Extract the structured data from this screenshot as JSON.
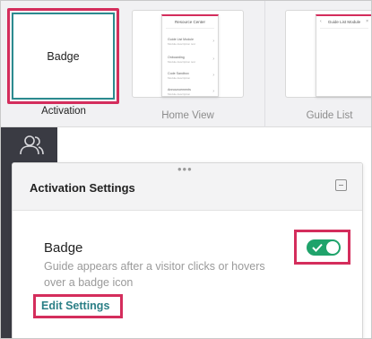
{
  "layouts": {
    "activation": {
      "caption": "Activation",
      "thumb_label": "Badge",
      "selected": true
    },
    "home_view": {
      "caption": "Home View",
      "modal_title": "Resource Center",
      "items": [
        {
          "label": "Guide List Module",
          "sub": "Module description text"
        },
        {
          "label": "Onboarding",
          "sub": "Module description text"
        },
        {
          "label": "Code Sandbox",
          "sub": "Module description"
        },
        {
          "label": "Announcements",
          "sub": "Module description"
        }
      ]
    },
    "guide_list": {
      "caption": "Guide List",
      "modal_title": "Guide List Module"
    }
  },
  "panel": {
    "title": "Activation Settings",
    "option_title": "Badge",
    "option_description": "Guide appears after a visitor clicks or hovers over a badge icon",
    "edit_link": "Edit Settings",
    "toggle_on": true
  },
  "colors": {
    "highlight": "#d42d5c",
    "teal": "#2b8a8f",
    "toggle_on": "#1fa36b",
    "sidebar": "#3a3b43"
  },
  "icons": [
    "users-icon",
    "drag-handle-icon",
    "collapse-icon",
    "check-icon",
    "chevron-right-icon",
    "close-icon",
    "back-icon"
  ]
}
